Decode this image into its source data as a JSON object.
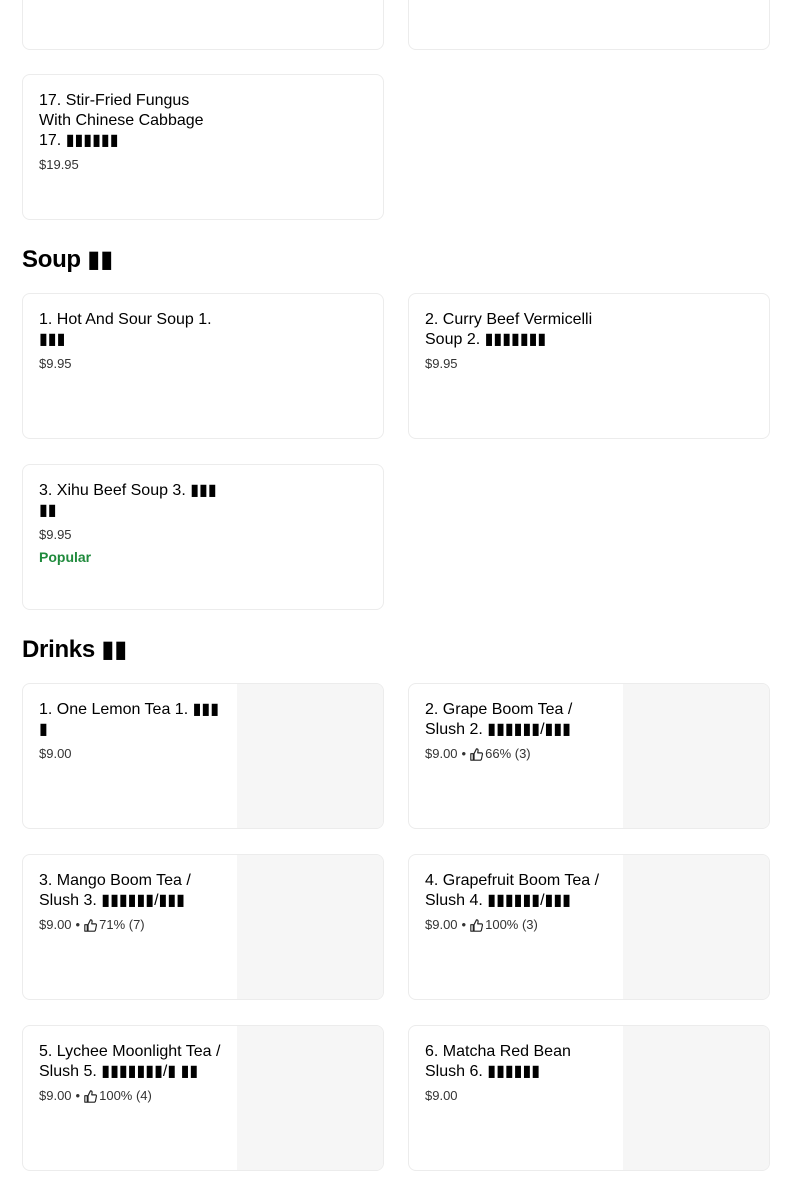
{
  "sections": {
    "top": {
      "items": [
        {
          "name": "17. Stir-Fried Fungus With Chinese Cabbage 17. ▮▮▮▮▮▮",
          "price": "$19.95"
        }
      ]
    },
    "soup": {
      "title": "Soup ▮▮",
      "items": [
        {
          "name": "1. Hot And Sour Soup 1. ▮▮▮",
          "price": "$9.95"
        },
        {
          "name": "2. Curry Beef Vermicelli Soup 2. ▮▮▮▮▮▮▮",
          "price": "$9.95"
        },
        {
          "name": "3. Xihu Beef Soup 3. ▮▮▮ ▮▮",
          "price": "$9.95",
          "badge": "Popular"
        }
      ]
    },
    "drinks": {
      "title": "Drinks ▮▮",
      "items": [
        {
          "name": "1. One Lemon Tea 1. ▮▮▮ ▮",
          "price": "$9.00"
        },
        {
          "name": "2. Grape Boom Tea / Slush 2. ▮▮▮▮▮▮/▮▮▮",
          "price": "$9.00",
          "rating": "66% (3)"
        },
        {
          "name": "3. Mango Boom Tea / Slush 3. ▮▮▮▮▮▮/▮▮▮",
          "price": "$9.00",
          "rating": "71% (7)"
        },
        {
          "name": "4. Grapefruit Boom Tea / Slush 4. ▮▮▮▮▮▮/▮▮▮",
          "price": "$9.00",
          "rating": "100% (3)"
        },
        {
          "name": "5. Lychee Moonlight Tea / Slush 5. ▮▮▮▮▮▮▮/▮ ▮▮",
          "price": "$9.00",
          "rating": "100% (4)"
        },
        {
          "name": "6. Matcha Red Bean Slush 6. ▮▮▮▮▮▮",
          "price": "$9.00"
        }
      ]
    }
  },
  "separator": "•",
  "icons": {
    "rating": "thumbs-up-icon"
  },
  "colors": {
    "popular": "#1f8a3c",
    "border": "#ececec",
    "image_placeholder": "#f6f6f6"
  }
}
